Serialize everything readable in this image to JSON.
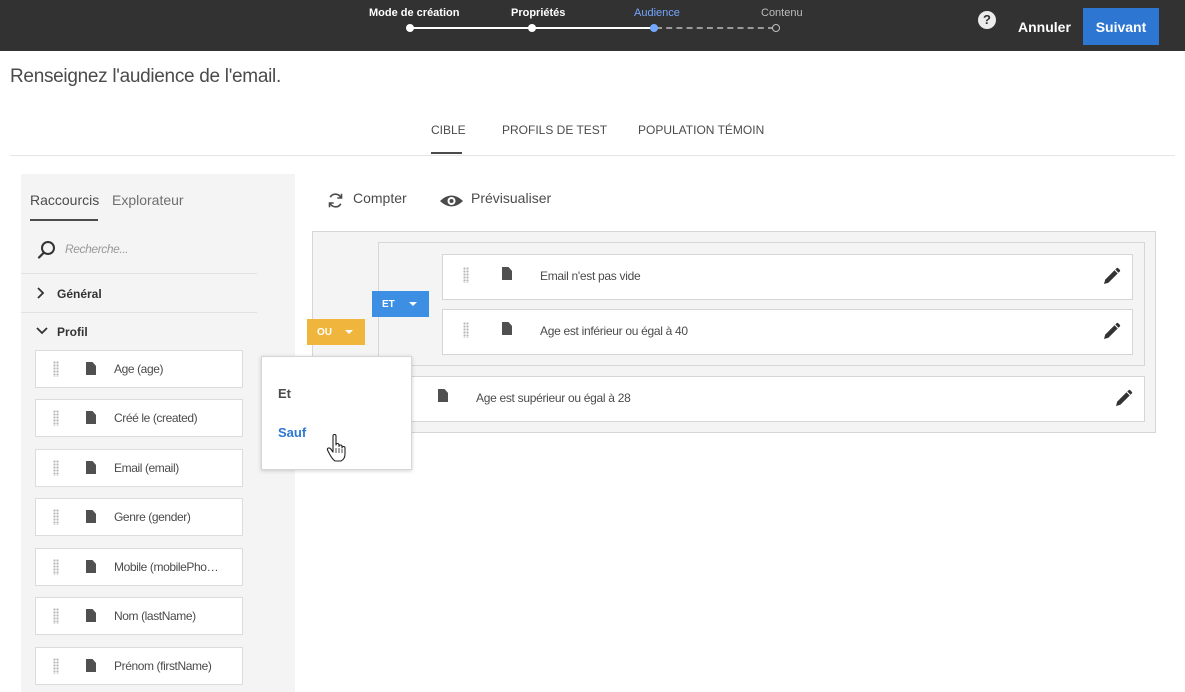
{
  "header": {
    "steps": [
      {
        "label": "Mode de création",
        "state": "done"
      },
      {
        "label": "Propriétés",
        "state": "done"
      },
      {
        "label": "Audience",
        "state": "active"
      },
      {
        "label": "Contenu",
        "state": "future"
      }
    ],
    "help_icon": "question-circle-icon",
    "cancel_label": "Annuler",
    "next_label": "Suivant",
    "accent_color": "#2d77d2"
  },
  "page": {
    "title": "Renseignez l'audience de l'email."
  },
  "tabs": [
    {
      "label": "CIBLE",
      "active": true
    },
    {
      "label": "PROFILS DE TEST",
      "active": false
    },
    {
      "label": "POPULATION TÉMOIN",
      "active": false
    }
  ],
  "left_panel": {
    "tabs": [
      {
        "label": "Raccourcis",
        "active": true
      },
      {
        "label": "Explorateur",
        "active": false
      }
    ],
    "search_placeholder": "Recherche...",
    "sections": [
      {
        "label": "Général",
        "expanded": false
      },
      {
        "label": "Profil",
        "expanded": true
      }
    ],
    "fields": [
      "Age (age)",
      "Créé le (created)",
      "Email (email)",
      "Genre (gender)",
      "Mobile (mobilePho…",
      "Nom (lastName)",
      "Prénom (firstName)"
    ]
  },
  "actions": {
    "count_label": "Compter",
    "preview_label": "Prévisualiser"
  },
  "query": {
    "or_operator": "OU",
    "and_operator": "ET",
    "and_rules": [
      "Email n'est pas vide",
      "Age est inférieur ou égal à 40"
    ],
    "or_rule": "Age est supérieur ou égal à 28",
    "or_color": "#f0b53c",
    "and_color": "#3d8fe4"
  },
  "dropdown": {
    "options": [
      {
        "label": "Et",
        "highlighted": false
      },
      {
        "label": "Sauf",
        "highlighted": true
      }
    ]
  }
}
